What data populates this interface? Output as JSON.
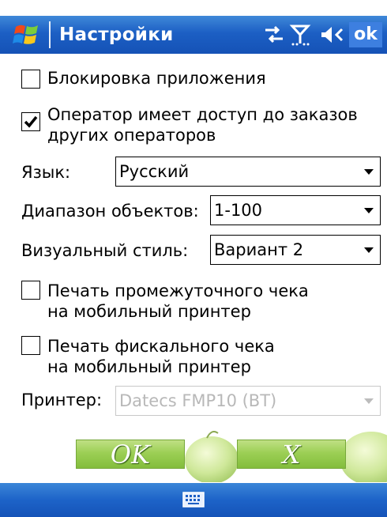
{
  "titlebar": {
    "title": "Настройки",
    "ok_label": "ok",
    "icons": [
      "windows-start-icon",
      "sync-arrows-icon",
      "signal-antenna-icon",
      "speaker-volume-icon"
    ],
    "colors": {
      "bar": "#1c5fc4",
      "ok_bg": "#3d7fe0"
    }
  },
  "form": {
    "lock_app": {
      "label": "Блокировка приложения",
      "checked": false
    },
    "operator_access": {
      "label_line1": "Оператор имеет доступ до заказов",
      "label_line2": "других операторов",
      "checked": true
    },
    "language": {
      "label": "Язык:",
      "value": "Русский"
    },
    "objects_range": {
      "label": "Диапазон объектов:",
      "value": "1-100"
    },
    "visual_style": {
      "label": "Визуальный стиль:",
      "value": "Вариант 2"
    },
    "print_interim": {
      "label_line1": "Печать промежуточного чека",
      "label_line2": "на мобильный принтер",
      "checked": false
    },
    "print_fiscal": {
      "label_line1": "Печать фискального чека",
      "label_line2": "на мобильный принтер",
      "checked": false
    },
    "printer": {
      "label": "Принтер:",
      "value": "Datecs FMP10 (BT)",
      "disabled": true
    }
  },
  "buttons": {
    "ok_label": "OK",
    "cancel_label": "X",
    "color": "#9ccf55"
  },
  "menubar": {
    "icon": "keyboard-icon"
  }
}
